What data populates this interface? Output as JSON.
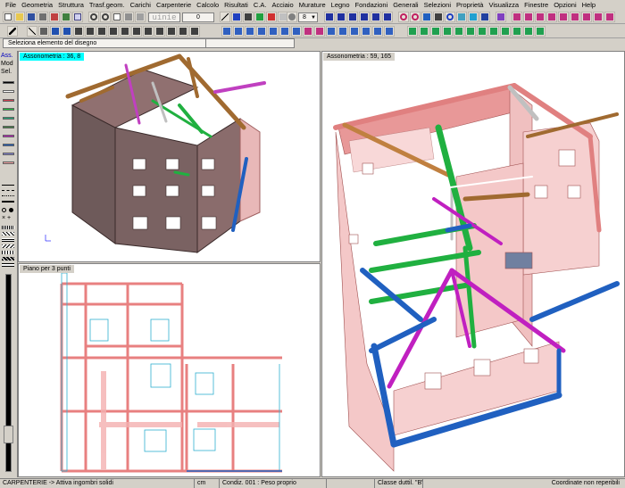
{
  "menu": [
    "File",
    "Geometria",
    "Struttura",
    "Trasf.geom.",
    "Carichi",
    "Carpenterie",
    "Calcolo",
    "Risultati",
    "C.A.",
    "Acciaio",
    "Murature",
    "Legno",
    "Fondazioni",
    "Generali",
    "Selezioni",
    "Proprietà",
    "Visualizza",
    "Finestre",
    "Opzioni",
    "Help"
  ],
  "toolbar": {
    "input_value": "0",
    "number_value": "8",
    "unit_field": "uinie"
  },
  "hint": {
    "text": "Seleziona  elemento del disegno"
  },
  "palette": {
    "labels": [
      "Ass.",
      "Mod",
      "Sel."
    ],
    "colors": [
      "#000000",
      "#ffffff",
      "#d04050",
      "#20c040",
      "#20a878",
      "#408040",
      "#c020c0",
      "#2060c0",
      "#8080d0",
      "#f0a0a0"
    ]
  },
  "viewports": {
    "top_left": {
      "title": "Assonometria :  36, 8"
    },
    "bottom_left": {
      "title": "Piano per 3 punti"
    },
    "right": {
      "title": "Assonometria :  59, 165"
    }
  },
  "status": {
    "mode": "CARPENTERIE -> Attiva ingombri solidi",
    "units": "cm",
    "load": "Condiz. 001 : Peso proprio",
    "class": "Classe duttil. \"B\"",
    "coords": "Coordinate non reperibili"
  }
}
